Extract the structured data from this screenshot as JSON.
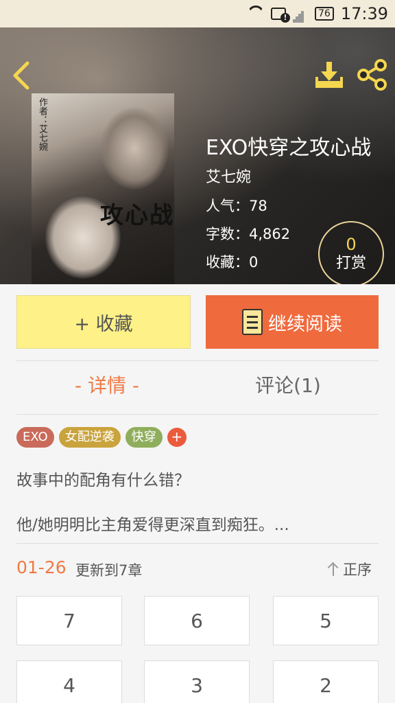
{
  "status_bar": {
    "battery": "76",
    "time": "17:39"
  },
  "book": {
    "title": "EXO快穿之攻心战",
    "author": "艾七婉",
    "popularity": "人气：78",
    "word_count": "字数：4,862",
    "favorites": "收藏：0",
    "cover": {
      "title": "攻心战",
      "author_text": "作者：艾七婉"
    }
  },
  "tip": {
    "count": "0",
    "label": "打赏"
  },
  "actions": {
    "favorite_label": "+ 收藏",
    "continue_label": "继续阅读"
  },
  "tabs": {
    "detail": "- 详情 -",
    "comments": "评论(1)"
  },
  "tags": [
    {
      "label": "EXO",
      "color": "#c96a5a"
    },
    {
      "label": "女配逆袭",
      "color": "#c9a33c"
    },
    {
      "label": "快穿",
      "color": "#8fae5d"
    }
  ],
  "tag_add": "+",
  "description": {
    "line1": "故事中的配角有什么错？",
    "line2": "他/她明明比主角爱得更深直到痴狂。..."
  },
  "update": {
    "date": "01-26",
    "text": "更新到7章",
    "sort_label": "正序"
  },
  "chapters": [
    "7",
    "6",
    "5",
    "4",
    "3",
    "2"
  ],
  "colors": {
    "accent_orange": "#ef6a3d",
    "fav_yellow": "#fdf187",
    "icon_yellow": "#f5d64f"
  }
}
